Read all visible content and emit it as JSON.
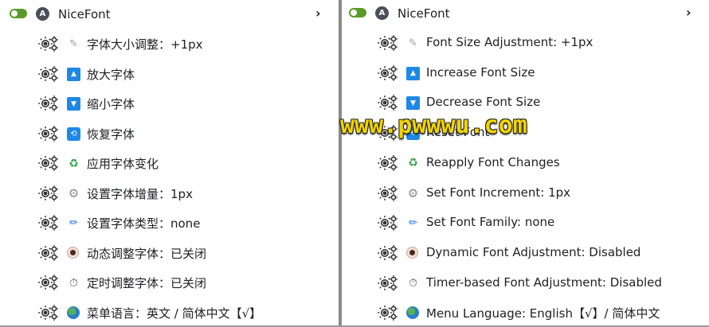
{
  "left": {
    "header": {
      "title": "NiceFont",
      "app_icon_letter": "A",
      "chevron": "›"
    },
    "items": [
      {
        "icon": "pencil-icon",
        "glyph": "✎",
        "label": "字体大小调整：+1px"
      },
      {
        "icon": "arrow-up-icon",
        "glyph": "▲",
        "label": "放大字体"
      },
      {
        "icon": "arrow-down-icon",
        "glyph": "▼",
        "label": "缩小字体"
      },
      {
        "icon": "reset-icon",
        "glyph": "⟲",
        "label": "恢复字体"
      },
      {
        "icon": "recycle-icon",
        "glyph": "♻",
        "label": "应用字体变化"
      },
      {
        "icon": "cog-icon",
        "glyph": "⚙",
        "label": "设置字体增量：1px"
      },
      {
        "icon": "brush-icon",
        "glyph": "✏",
        "label": "设置字体类型：none"
      },
      {
        "icon": "eye-icon",
        "glyph": "",
        "label": "动态调整字体：已关闭"
      },
      {
        "icon": "timer-icon",
        "glyph": "⏱",
        "label": "定时调整字体：已关闭"
      },
      {
        "icon": "globe-icon",
        "glyph": "",
        "label": "菜单语言：英文 / 简体中文【√】"
      }
    ]
  },
  "right": {
    "header": {
      "title": "NiceFont",
      "app_icon_letter": "A",
      "chevron": "›"
    },
    "items": [
      {
        "icon": "pencil-icon",
        "glyph": "✎",
        "label": "Font Size Adjustment: +1px"
      },
      {
        "icon": "arrow-up-icon",
        "glyph": "▲",
        "label": "Increase Font Size"
      },
      {
        "icon": "arrow-down-icon",
        "glyph": "▼",
        "label": "Decrease Font Size"
      },
      {
        "icon": "reset-icon",
        "glyph": "⟲",
        "label": "Reset Font"
      },
      {
        "icon": "recycle-icon",
        "glyph": "♻",
        "label": "Reapply Font Changes"
      },
      {
        "icon": "cog-icon",
        "glyph": "⚙",
        "label": "Set Font Increment: 1px"
      },
      {
        "icon": "brush-icon",
        "glyph": "✏",
        "label": "Set Font Family: none"
      },
      {
        "icon": "eye-icon",
        "glyph": "",
        "label": "Dynamic Font Adjustment: Disabled"
      },
      {
        "icon": "timer-icon",
        "glyph": "⏱",
        "label": "Timer-based Font Adjustment: Disabled"
      },
      {
        "icon": "globe-icon",
        "glyph": "",
        "label": "Menu Language: English【√】/ 简体中文"
      }
    ]
  },
  "watermark": "www.pwwwu.com",
  "colors": {
    "toggle_on": "#5a9a2a",
    "accent_blue": "#1e88e5",
    "watermark": "#f2d400"
  }
}
